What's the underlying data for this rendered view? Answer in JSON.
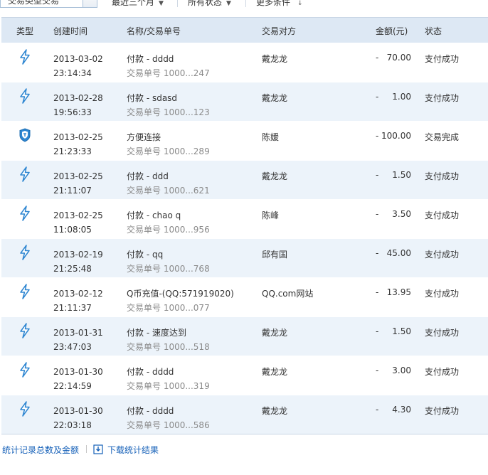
{
  "filters": {
    "type_value": "交易类型交易",
    "period": "最近三个月",
    "status": "所有状态",
    "more": "更多条件"
  },
  "columns": {
    "type": "类型",
    "created": "创建时间",
    "name": "名称/交易单号",
    "party": "交易对方",
    "amount": "金额(元)",
    "status": "状态"
  },
  "colors": {
    "header_bg": "#dde8f4",
    "row_alt_bg": "#ecf3fa",
    "icon_blue": "#2e86d1",
    "link": "#1560b8"
  },
  "rows": [
    {
      "icon": "lightning-icon",
      "date": "2013-03-02",
      "time": "23:14:34",
      "name": "付款 - dddd",
      "order": "交易单号 1000...247",
      "party": "戴龙龙",
      "sign": "-",
      "amount": "70.00",
      "status": "支付成功"
    },
    {
      "icon": "lightning-icon",
      "date": "2013-02-28",
      "time": "19:56:33",
      "name": "付款 - sdasd",
      "order": "交易单号 1000...123",
      "party": "戴龙龙",
      "sign": "-",
      "amount": "1.00",
      "status": "支付成功"
    },
    {
      "icon": "shield-icon",
      "date": "2013-02-25",
      "time": "21:23:33",
      "name": "方便连接",
      "order": "交易单号 1000...289",
      "party": "陈媛",
      "sign": "-",
      "amount": "100.00",
      "status": "交易完成"
    },
    {
      "icon": "lightning-icon",
      "date": "2013-02-25",
      "time": "21:11:07",
      "name": "付款 - ddd",
      "order": "交易单号 1000...621",
      "party": "戴龙龙",
      "sign": "-",
      "amount": "1.50",
      "status": "支付成功"
    },
    {
      "icon": "lightning-icon",
      "date": "2013-02-25",
      "time": "11:08:05",
      "name": "付款 - chao q",
      "order": "交易单号 1000...956",
      "party": "陈峰",
      "sign": "-",
      "amount": "3.50",
      "status": "支付成功"
    },
    {
      "icon": "lightning-icon",
      "date": "2013-02-19",
      "time": "21:25:48",
      "name": "付款 - qq",
      "order": "交易单号 1000...768",
      "party": "邱有国",
      "sign": "-",
      "amount": "45.00",
      "status": "支付成功"
    },
    {
      "icon": "lightning-icon",
      "date": "2013-02-12",
      "time": "21:11:37",
      "name": "Q币充值-(QQ:571919020)",
      "order": "交易单号 1000...077",
      "party": "QQ.com网站",
      "sign": "-",
      "amount": "13.95",
      "status": "支付成功"
    },
    {
      "icon": "lightning-icon",
      "date": "2013-01-31",
      "time": "23:47:03",
      "name": "付款 - 速度达到",
      "order": "交易单号 1000...518",
      "party": "戴龙龙",
      "sign": "-",
      "amount": "1.50",
      "status": "支付成功"
    },
    {
      "icon": "lightning-icon",
      "date": "2013-01-30",
      "time": "22:14:59",
      "name": "付款 - dddd",
      "order": "交易单号 1000...319",
      "party": "戴龙龙",
      "sign": "-",
      "amount": "3.00",
      "status": "支付成功"
    },
    {
      "icon": "lightning-icon",
      "date": "2013-01-30",
      "time": "22:03:18",
      "name": "付款 - dddd",
      "order": "交易单号 1000...586",
      "party": "戴龙龙",
      "sign": "-",
      "amount": "4.30",
      "status": "支付成功"
    }
  ],
  "footer": {
    "stats_link": "统计记录总数及金额",
    "download_link": "下载统计结果"
  }
}
